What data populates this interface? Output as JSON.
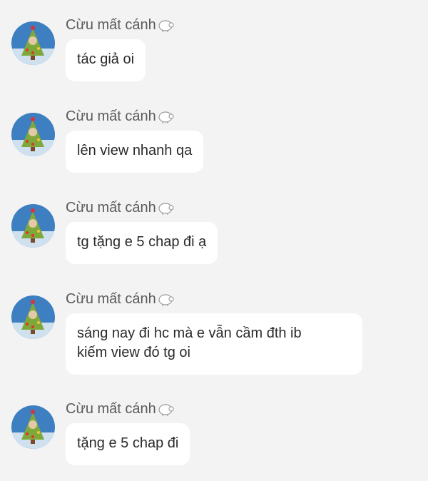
{
  "messages": [
    {
      "sender": "Cừu mất cánh",
      "sender_icon": "sheep-icon",
      "text": "tác giả oi"
    },
    {
      "sender": "Cừu mất cánh",
      "sender_icon": "sheep-icon",
      "text": "lên view nhanh qa"
    },
    {
      "sender": "Cừu mất cánh",
      "sender_icon": "sheep-icon",
      "text": "tg tặng e 5 chap đi ạ"
    },
    {
      "sender": "Cừu mất cánh",
      "sender_icon": "sheep-icon",
      "text": "sáng nay đi hc mà e vẫn cầm đth ib\nkiếm view đó tg oi"
    },
    {
      "sender": "Cừu mất cánh",
      "sender_icon": "sheep-icon",
      "text": "tặng e 5 chap đi"
    }
  ],
  "colors": {
    "background": "#f3f3f4",
    "bubble": "#ffffff",
    "sender_text": "#5b5b5b",
    "message_text": "#2a2a2a",
    "avatar_sky": "#3d7fc0",
    "avatar_tree": "#7fa83a"
  }
}
